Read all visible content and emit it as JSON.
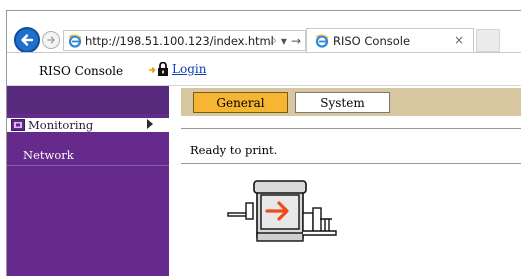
{
  "browser": {
    "url": "http://198.51.100.123/index.html",
    "search_glyph": "⌕",
    "dropdown_glyph": "▾",
    "go_glyph": "→",
    "tab_title": "RISO Console",
    "tab_close": "×",
    "icons": {
      "back": "back-arrow-icon",
      "forward": "forward-arrow-icon",
      "site": "ie-logo-icon"
    },
    "colors": {
      "back_button": "#1e6fcf",
      "tab_border": "#c9c9c9"
    }
  },
  "header": {
    "app_title": "RISO Console",
    "login_label": "Login",
    "icons": {
      "login": "lock-icon"
    }
  },
  "sidebar": {
    "items": [
      {
        "label": "Monitoring",
        "active": true,
        "icon": "monitoring-icon"
      },
      {
        "label": "Network",
        "active": false
      }
    ],
    "colors": {
      "background": "#662a8c",
      "active_bg": "#ffffff"
    }
  },
  "main": {
    "tabs": [
      {
        "label": "General",
        "selected": true
      },
      {
        "label": "System",
        "selected": false
      }
    ],
    "status": "Ready to print.",
    "illustration": "printer-icon",
    "colors": {
      "tab_strip": "#d6c7a1",
      "selected_tab": "#f6b633",
      "arrow": "#f04a1a"
    }
  }
}
